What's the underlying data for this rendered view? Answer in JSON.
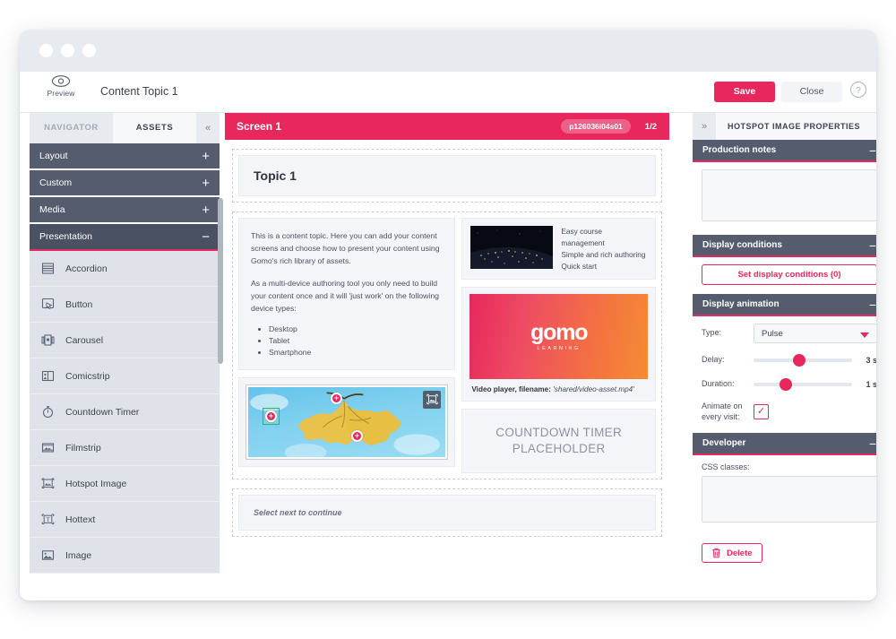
{
  "window": {
    "dots": [
      "dot-1",
      "dot-2",
      "dot-3"
    ]
  },
  "toolbar": {
    "preview_label": "Preview",
    "preview_icon": "eye-icon",
    "document_title": "Content Topic 1",
    "save_label": "Save",
    "close_label": "Close",
    "help_icon": "help-circle-icon",
    "accent_color": "#e8275c"
  },
  "left_panel": {
    "tabs": [
      {
        "label": "NAVIGATOR",
        "active": false
      },
      {
        "label": "ASSETS",
        "active": true
      }
    ],
    "collapse_icon": "«",
    "categories": [
      {
        "label": "Layout",
        "sign": "+",
        "open": false
      },
      {
        "label": "Custom",
        "sign": "+",
        "open": false
      },
      {
        "label": "Media",
        "sign": "+",
        "open": false
      },
      {
        "label": "Presentation",
        "sign": "−",
        "open": true
      }
    ],
    "assets": [
      {
        "label": "Accordion",
        "icon": "accordion-icon"
      },
      {
        "label": "Button",
        "icon": "button-icon"
      },
      {
        "label": "Carousel",
        "icon": "carousel-icon"
      },
      {
        "label": "Comicstrip",
        "icon": "comicstrip-icon"
      },
      {
        "label": "Countdown Timer",
        "icon": "stopwatch-icon"
      },
      {
        "label": "Filmstrip",
        "icon": "filmstrip-icon"
      },
      {
        "label": "Hotspot Image",
        "icon": "hotspot-image-icon"
      },
      {
        "label": "Hottext",
        "icon": "hottext-icon"
      },
      {
        "label": "Image",
        "icon": "image-icon"
      }
    ]
  },
  "center": {
    "screen_title": "Screen 1",
    "screen_id": "p126036i04s01",
    "page_indicator": "1/2",
    "topic_title": "Topic 1",
    "paragraphs": [
      "This is a content topic. Here you can add your content screens and choose how to present your content using Gomo's rich library of assets.",
      "As a multi-device authoring tool you only need to build your content once and it will 'just work' on the following device types:"
    ],
    "device_list": [
      "Desktop",
      "Tablet",
      "Smartphone"
    ],
    "hotspot": {
      "icon": "hotspot-edit-icon",
      "markers": [
        "hotspot-marker-1",
        "hotspot-marker-2",
        "hotspot-marker-3"
      ],
      "marker_glyph": "+"
    },
    "media_lines": [
      "Easy course management",
      "Simple and rich authoring",
      "Quick start"
    ],
    "video": {
      "logo_word": "gomo",
      "logo_sub": "LEARNING",
      "caption_label": "Video player, filename:",
      "caption_file": "'shared/video-asset.mp4'"
    },
    "countdown_placeholder": "COUNTDOWN TIMER\nPLACEHOLDER",
    "countdown_line1": "COUNTDOWN TIMER",
    "countdown_line2": "PLACEHOLDER",
    "next_text": "Select next to continue"
  },
  "right_panel": {
    "expand_icon": "»",
    "title": "HOTSPOT IMAGE PROPERTIES",
    "sections": {
      "production_notes": {
        "label": "Production notes",
        "sign": "−",
        "value": ""
      },
      "display_conditions": {
        "label": "Display conditions",
        "sign": "−",
        "button_label": "Set display conditions (0)"
      },
      "display_animation": {
        "label": "Display animation",
        "sign": "−",
        "type_label": "Type:",
        "type_value": "Pulse",
        "delay_label": "Delay:",
        "delay_value": "3 s",
        "delay_pct": 40,
        "duration_label": "Duration:",
        "duration_value": "1 s",
        "duration_pct": 26,
        "animate_label_line1": "Animate on",
        "animate_label_line2": "every visit:",
        "animate_checked": true,
        "check_glyph": "✓"
      },
      "developer": {
        "label": "Developer",
        "sign": "−",
        "css_label": "CSS classes:",
        "css_value": ""
      }
    },
    "delete_label": "Delete",
    "delete_icon": "trash-icon"
  }
}
